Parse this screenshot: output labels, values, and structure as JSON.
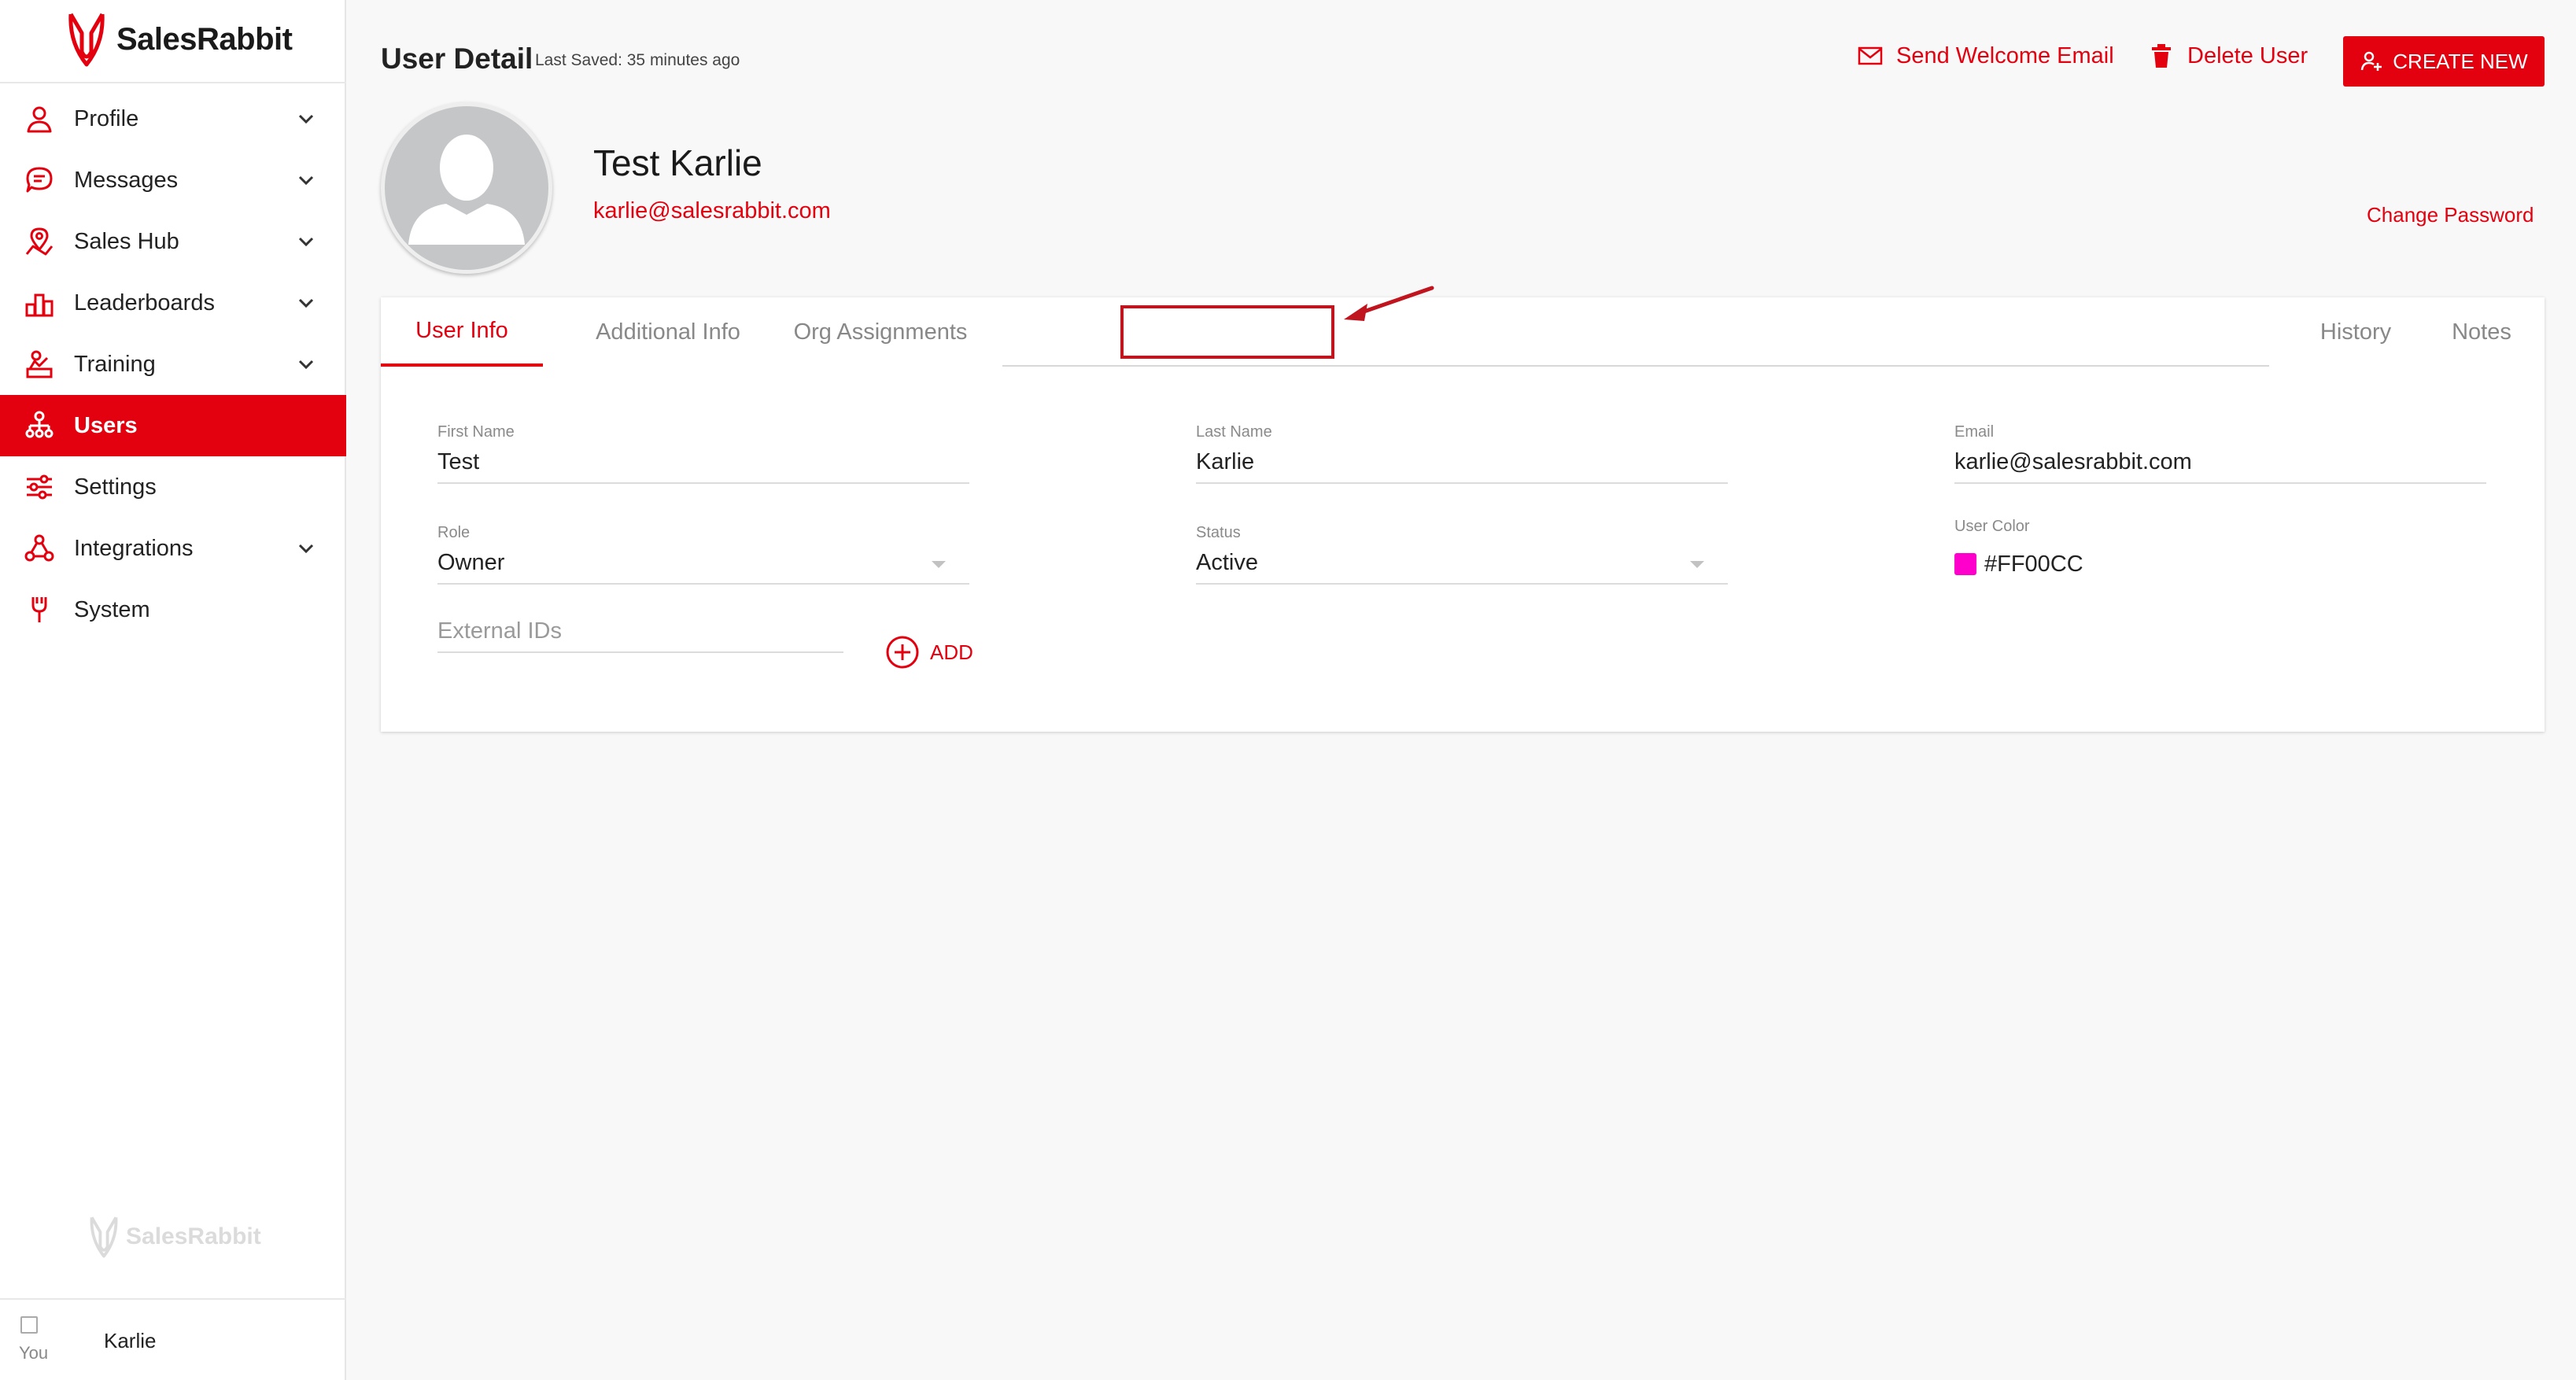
{
  "app": {
    "brand": "SalesRabbit"
  },
  "sidebar": {
    "items": [
      {
        "label": "Profile",
        "icon": "user-icon",
        "expandable": true
      },
      {
        "label": "Messages",
        "icon": "message-icon",
        "expandable": true
      },
      {
        "label": "Sales Hub",
        "icon": "map-pin-icon",
        "expandable": true
      },
      {
        "label": "Leaderboards",
        "icon": "leaderboard-icon",
        "expandable": true
      },
      {
        "label": "Training",
        "icon": "training-icon",
        "expandable": true
      },
      {
        "label": "Users",
        "icon": "users-tree-icon",
        "expandable": false,
        "active": true
      },
      {
        "label": "Settings",
        "icon": "sliders-icon",
        "expandable": false
      },
      {
        "label": "Integrations",
        "icon": "integrations-icon",
        "expandable": true
      },
      {
        "label": "System",
        "icon": "system-icon",
        "expandable": false
      }
    ],
    "footer_brand": "SalesRabbit",
    "current_user": {
      "name": "Karlie",
      "avatar_alt": "You"
    }
  },
  "header": {
    "title": "User Detail",
    "last_saved_label": "Last Saved:",
    "last_saved_value": "35 minutes ago",
    "send_welcome_label": "Send Welcome Email",
    "delete_user_label": "Delete User",
    "create_new_label": "CREATE NEW"
  },
  "profile": {
    "name": "Test Karlie",
    "email": "karlie@salesrabbit.com",
    "change_password_label": "Change Password"
  },
  "tabs": {
    "user_info": "User Info",
    "additional_info": "Additional Info",
    "org_assignments": "Org Assignments",
    "history": "History",
    "notes": "Notes"
  },
  "form": {
    "first_name": {
      "label": "First Name",
      "value": "Test"
    },
    "last_name": {
      "label": "Last Name",
      "value": "Karlie"
    },
    "email": {
      "label": "Email",
      "value": "karlie@salesrabbit.com"
    },
    "role": {
      "label": "Role",
      "value": "Owner"
    },
    "status": {
      "label": "Status",
      "value": "Active"
    },
    "user_color": {
      "label": "User Color",
      "value": "#FF00CC"
    },
    "external_ids": {
      "placeholder": "External IDs"
    },
    "add_label": "ADD"
  },
  "colors": {
    "accent": "#e3000f",
    "user_color_swatch": "#FF00CC",
    "annotation": "#c0141e"
  }
}
